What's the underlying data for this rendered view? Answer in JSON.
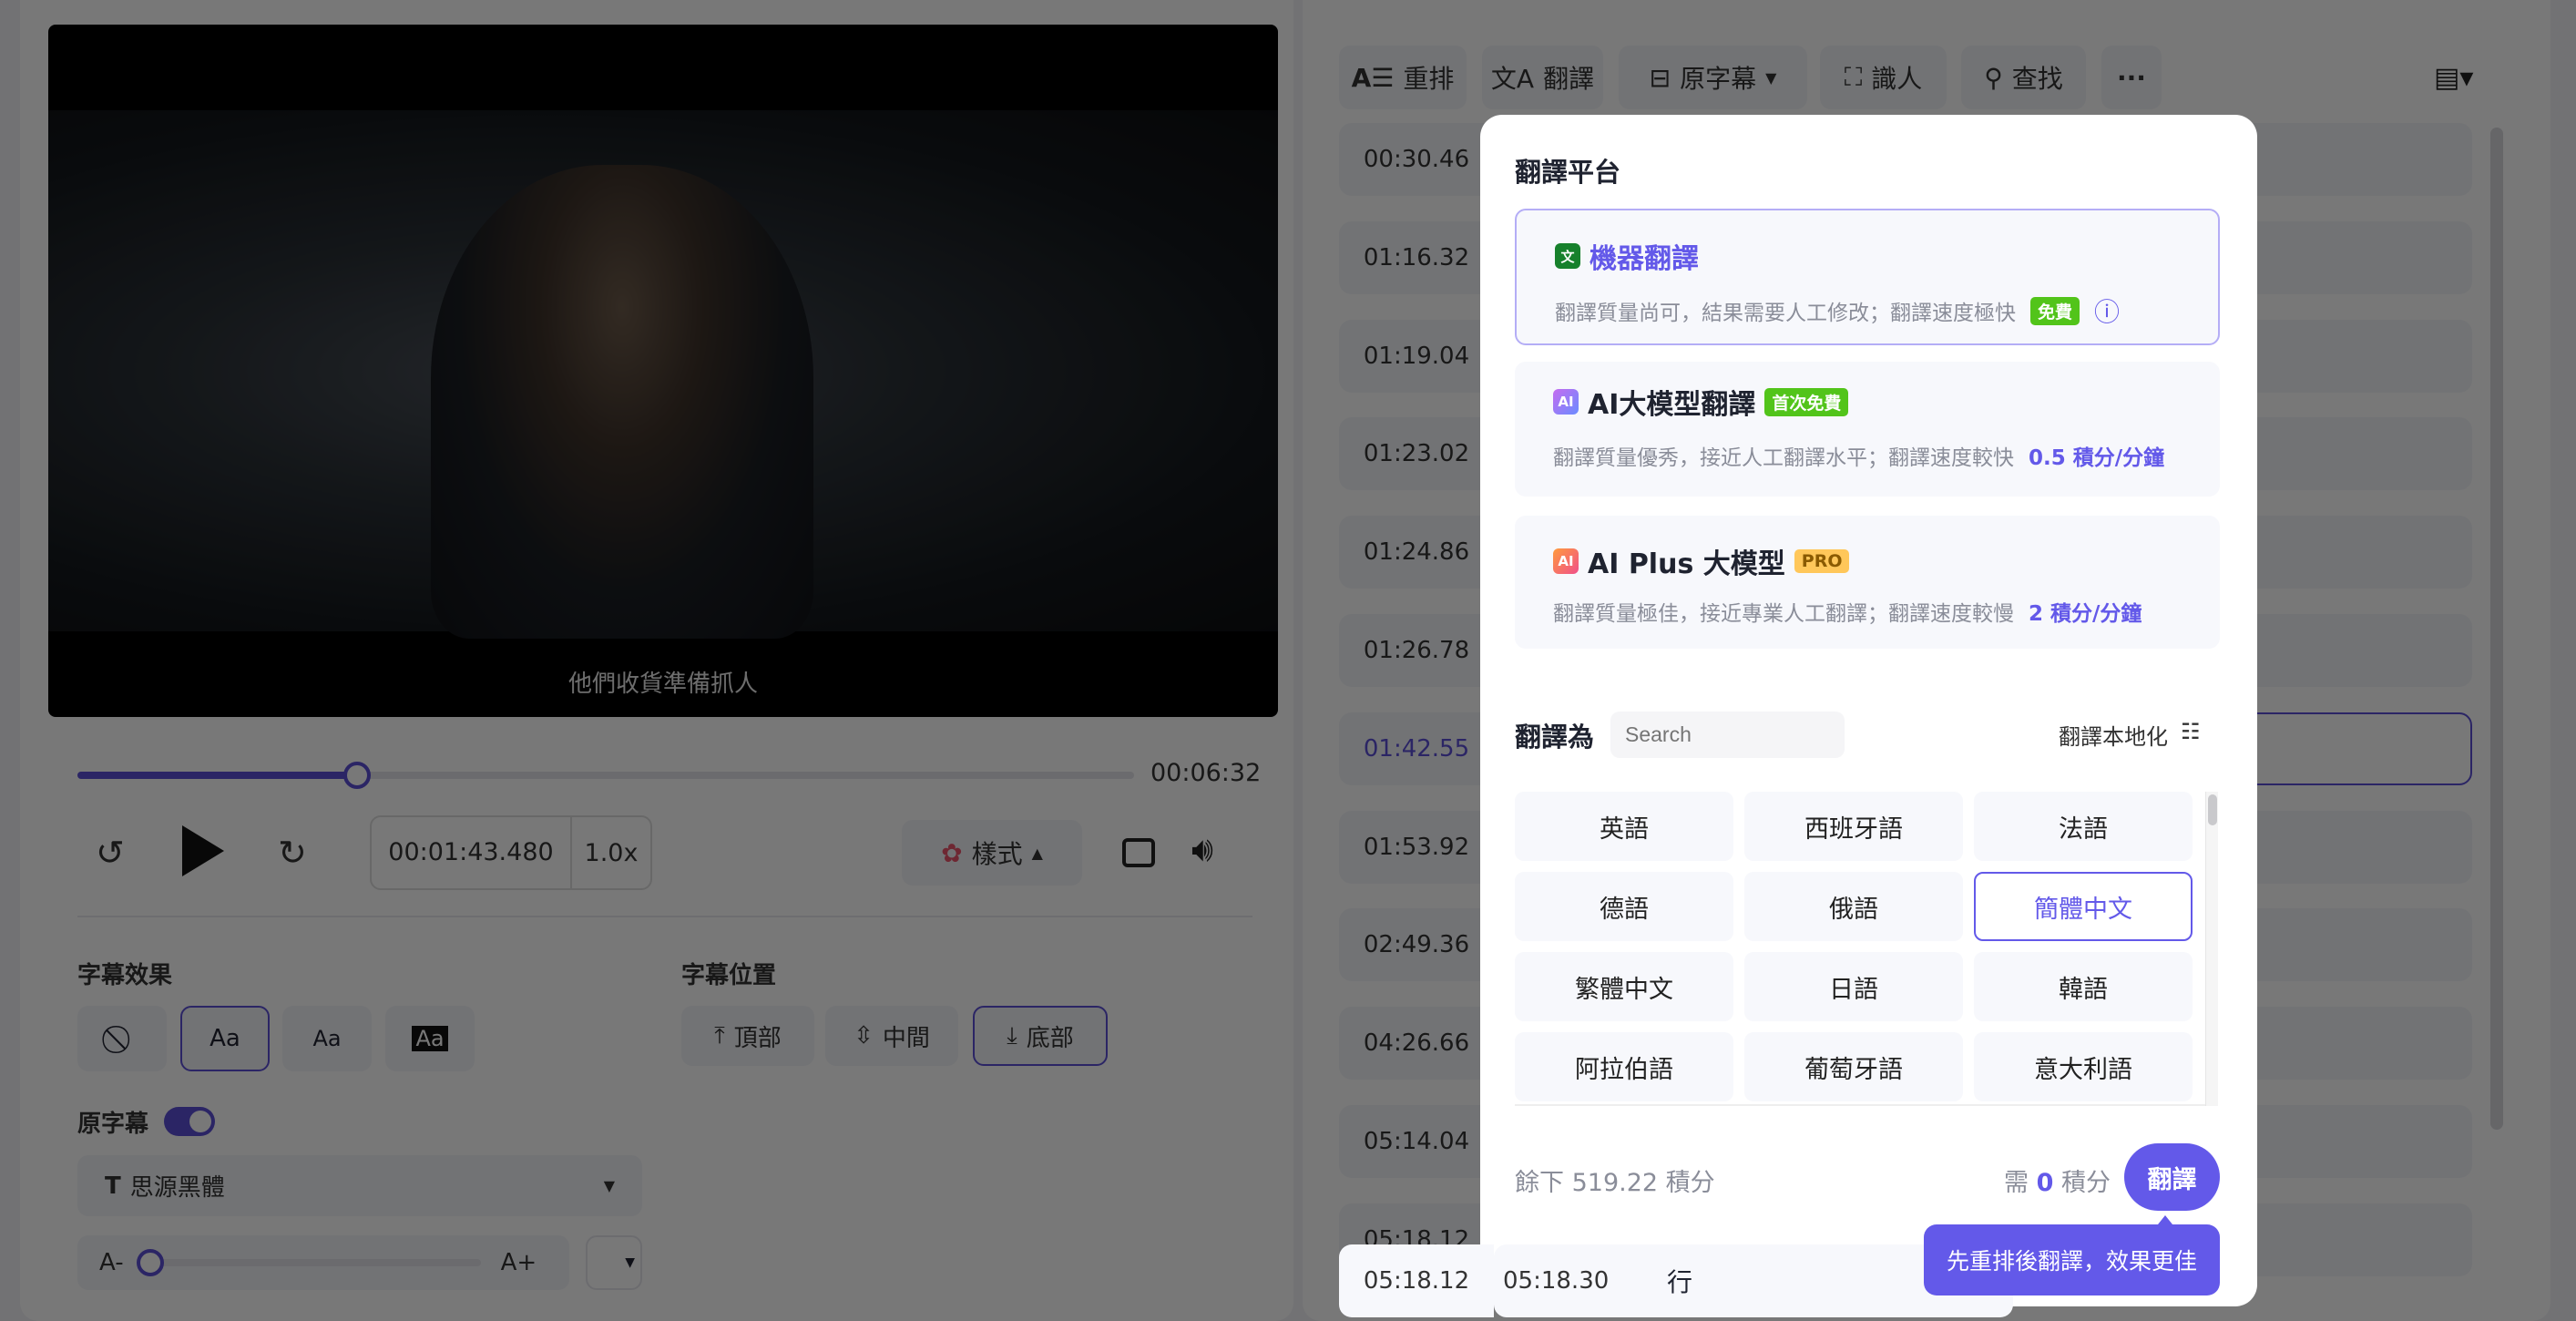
{
  "player": {
    "subtitle": "他們收貨準備抓人",
    "progress_fraction": 0.265,
    "duration": "00:06:32",
    "current_time": "00:01:43.480",
    "speed": "1.0x",
    "style_label": "樣式"
  },
  "style_panel": {
    "effect_label": "字幕效果",
    "effects": [
      "Aa",
      "Aa",
      "Aa"
    ],
    "position_label": "字幕位置",
    "positions": [
      "頂部",
      "中間",
      "底部"
    ],
    "selected_position": "底部",
    "original_label": "原字幕",
    "original_on": true,
    "font": "思源黑體",
    "size_minus": "A-",
    "size_plus": "A+",
    "size_fraction": 0.02
  },
  "toolbar": {
    "items": [
      "重排",
      "翻譯",
      "原字幕",
      "識人",
      "查找"
    ]
  },
  "rows": [
    {
      "start": "00:30.46"
    },
    {
      "start": "01:16.32"
    },
    {
      "start": "01:19.04"
    },
    {
      "start": "01:23.02"
    },
    {
      "start": "01:24.86"
    },
    {
      "start": "01:26.78"
    },
    {
      "start": "01:42.55",
      "active": true
    },
    {
      "start": "01:53.92"
    },
    {
      "start": "02:49.36"
    },
    {
      "start": "04:26.66"
    },
    {
      "start": "05:14.04"
    },
    {
      "start": "05:18.12",
      "end": "05:18.30",
      "text": "行"
    }
  ],
  "modal": {
    "title": "翻譯平台",
    "platforms": [
      {
        "name": "機器翻譯",
        "desc": "翻譯質量尚可，結果需要人工修改；翻譯速度極快",
        "badge": "免費",
        "selected": true
      },
      {
        "name": "AI大模型翻譯",
        "badge": "首次免費",
        "desc": "翻譯質量優秀，接近人工翻譯水平；翻譯速度較快",
        "price": "0.5 積分/分鐘"
      },
      {
        "name": "AI Plus 大模型",
        "badge": "PRO",
        "desc": "翻譯質量極佳，接近專業人工翻譯；翻譯速度較慢",
        "price": "2 積分/分鐘"
      }
    ],
    "target_label": "翻譯為",
    "search_placeholder": "Search",
    "localize_label": "翻譯本地化",
    "languages": [
      "英語",
      "西班牙語",
      "法語",
      "德語",
      "俄語",
      "簡體中文",
      "繁體中文",
      "日語",
      "韓語",
      "阿拉伯語",
      "葡萄牙語",
      "意大利語"
    ],
    "selected_language": "簡體中文",
    "remaining": "餘下 519.22 積分",
    "need_prefix": "需",
    "need_value": "0",
    "need_suffix": "積分",
    "translate_button": "翻譯",
    "tooltip": "先重排後翻譯，效果更佳"
  },
  "colors": {
    "accent": "#6359e9",
    "free_badge": "#52c41a",
    "pro_badge": "#ffc75a"
  }
}
